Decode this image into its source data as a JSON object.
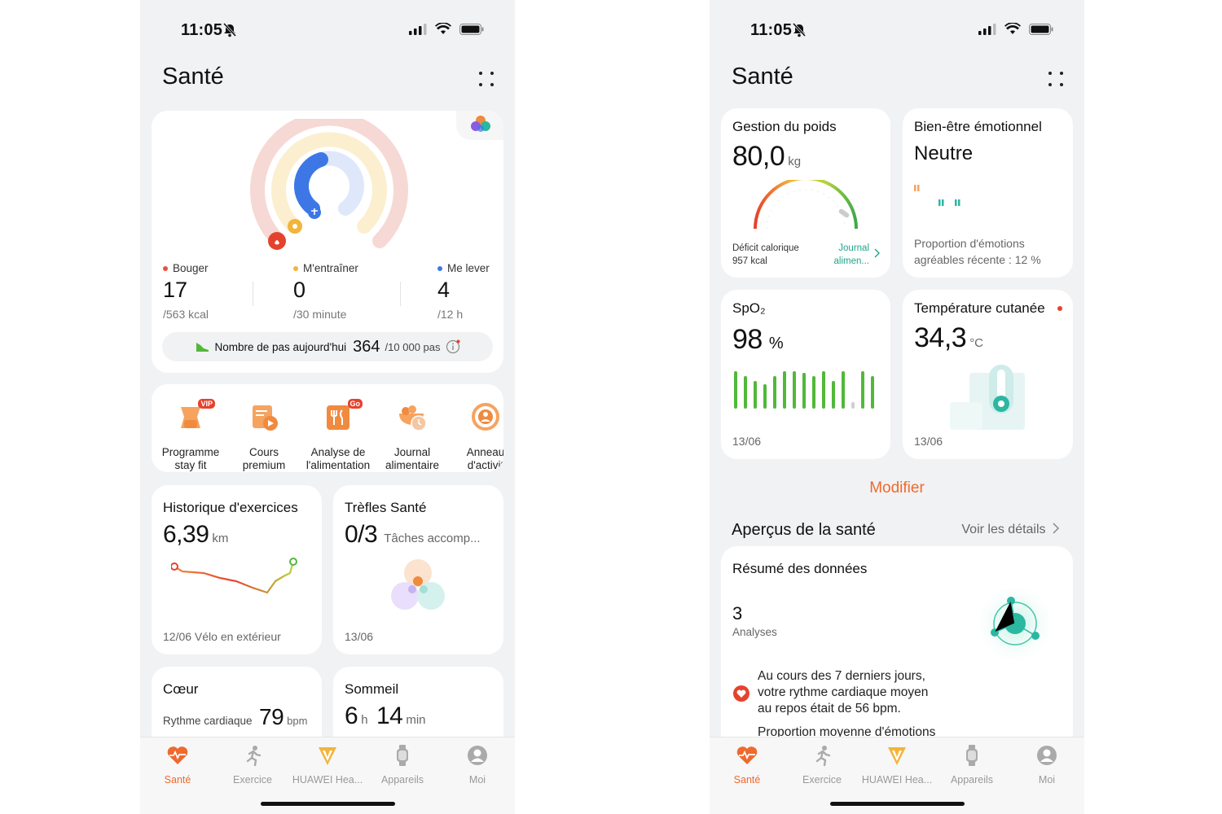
{
  "status": {
    "time": "11:05"
  },
  "left": {
    "title": "Santé",
    "activity": {
      "stats": [
        {
          "label": "Bouger",
          "value": "17",
          "goal": "/563 kcal",
          "color": "#e9513d"
        },
        {
          "label": "M'entraîner",
          "value": "0",
          "goal": "/30 minute",
          "color": "#f4b43a"
        },
        {
          "label": "Me lever",
          "value": "4",
          "goal": "/12 h",
          "color": "#3d77e6"
        }
      ],
      "steps_label": "Nombre de pas aujourd'hui",
      "steps_count": "364",
      "steps_goal": "/10 000 pas"
    },
    "shortcuts": [
      {
        "label": "Programme\nstay fit",
        "badge": "VIP"
      },
      {
        "label": "Cours\npremium",
        "badge": ""
      },
      {
        "label": "Analyse de\nl'alimentation",
        "badge": "Go"
      },
      {
        "label": "Journal\nalimentaire",
        "badge": ""
      },
      {
        "label": "Anneau\nd'activit",
        "badge": ""
      }
    ],
    "exercise": {
      "title": "Historique d'exercices",
      "value": "6,39",
      "unit": "km",
      "footer": "12/06 Vélo en extérieur"
    },
    "clovers": {
      "title": "Trèfles Santé",
      "value": "0/3",
      "subtitle": "Tâches accomp...",
      "date": "13/06"
    },
    "heart": {
      "title": "Cœur",
      "label": "Rythme cardiaque",
      "value": "79",
      "unit": "bpm"
    },
    "sleep": {
      "title": "Sommeil",
      "hours": "6",
      "hours_unit": "h",
      "minutes": "14",
      "minutes_unit": "min"
    }
  },
  "right": {
    "title": "Santé",
    "weight": {
      "title": "Gestion du poids",
      "value": "80,0",
      "unit": "kg",
      "deficit_label": "Déficit calorique",
      "deficit_value": "957 kcal",
      "journal_link_1": "Journal",
      "journal_link_2": "alimen..."
    },
    "emotion": {
      "title": "Bien-être émotionnel",
      "value": "Neutre",
      "desc_1": "Proportion d'émotions",
      "desc_2": "agréables récente : 12 %"
    },
    "spo2": {
      "title": "SpO₂",
      "value": "98",
      "unit": "%",
      "date": "13/06"
    },
    "temperature": {
      "title": "Température cutanée",
      "value": "34,3",
      "unit": "°C",
      "date": "13/06"
    },
    "modify_label": "Modifier",
    "insights": {
      "title": "Aperçus de la santé",
      "link": "Voir les détails"
    },
    "summary": {
      "title": "Résumé des données",
      "count": "3",
      "count_label": "Analyses",
      "line_1": "Au cours des 7 derniers jours,",
      "line_2": "votre rythme cardiaque moyen",
      "line_3": "au repos était de 56 bpm.",
      "line_4": "Proportion moyenne d'émotions"
    }
  },
  "nav": [
    {
      "label": "Santé",
      "icon": "heart-pulse-icon"
    },
    {
      "label": "Exercice",
      "icon": "runner-icon"
    },
    {
      "label": "HUAWEI Hea...",
      "icon": "huawei-health-v-icon"
    },
    {
      "label": "Appareils",
      "icon": "watch-icon"
    },
    {
      "label": "Moi",
      "icon": "profile-icon"
    }
  ],
  "colors": {
    "accent": "#f0692d",
    "green": "#52b83a",
    "teal": "#2bb7a0"
  }
}
